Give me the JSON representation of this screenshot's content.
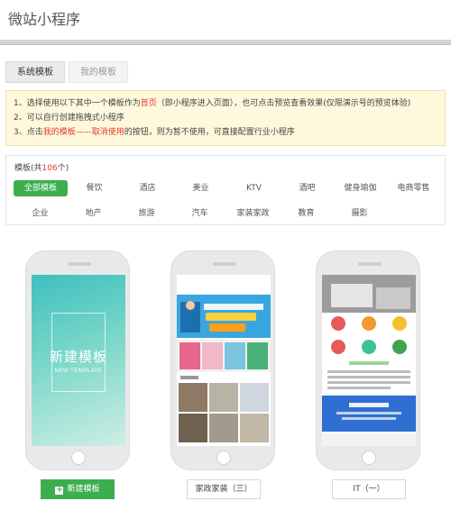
{
  "page": {
    "title": "微站小程序"
  },
  "tabs": [
    {
      "label": "系统模板",
      "active": true
    },
    {
      "label": "我的模板",
      "active": false
    }
  ],
  "notice": {
    "line1_a": "1、选择使用以下其中一个模板作为",
    "line1_b": "首页",
    "line1_c": "（即小程序进入页面），也可点击预览查看效果(仅限演示号的预览体验)",
    "line2": "2、可以自行创建拖拽式小程序",
    "line3_a": "3、点击",
    "line3_b": "我的模板——取消使用",
    "line3_c": "的按钮，则为暂不使用，可直接配置行业小程序"
  },
  "filter": {
    "count_prefix": "模板(共",
    "count_value": "106",
    "count_suffix": "个)",
    "row1": [
      "全部模板",
      "餐饮",
      "酒店",
      "美业",
      "KTV",
      "酒吧",
      "健身瑜伽",
      "电商零售"
    ],
    "row2": [
      "企业",
      "地产",
      "旅游",
      "汽车",
      "家装家政",
      "教育",
      "摄影"
    ]
  },
  "templates": [
    {
      "name": "新建模板",
      "button": "新建模板",
      "screen_title": "新建模板",
      "screen_sub": "NEW TEMPLATE"
    },
    {
      "name": "家政家装（三）",
      "button": "家政家装（三）",
      "screen_title": "",
      "screen_sub": ""
    },
    {
      "name": "IT（一）",
      "button": "IT（一）",
      "screen_title": "",
      "screen_sub": ""
    }
  ],
  "colors": {
    "accent": "#3dae4f",
    "highlight": "#e03c31",
    "notice_bg": "#fff8dc"
  }
}
